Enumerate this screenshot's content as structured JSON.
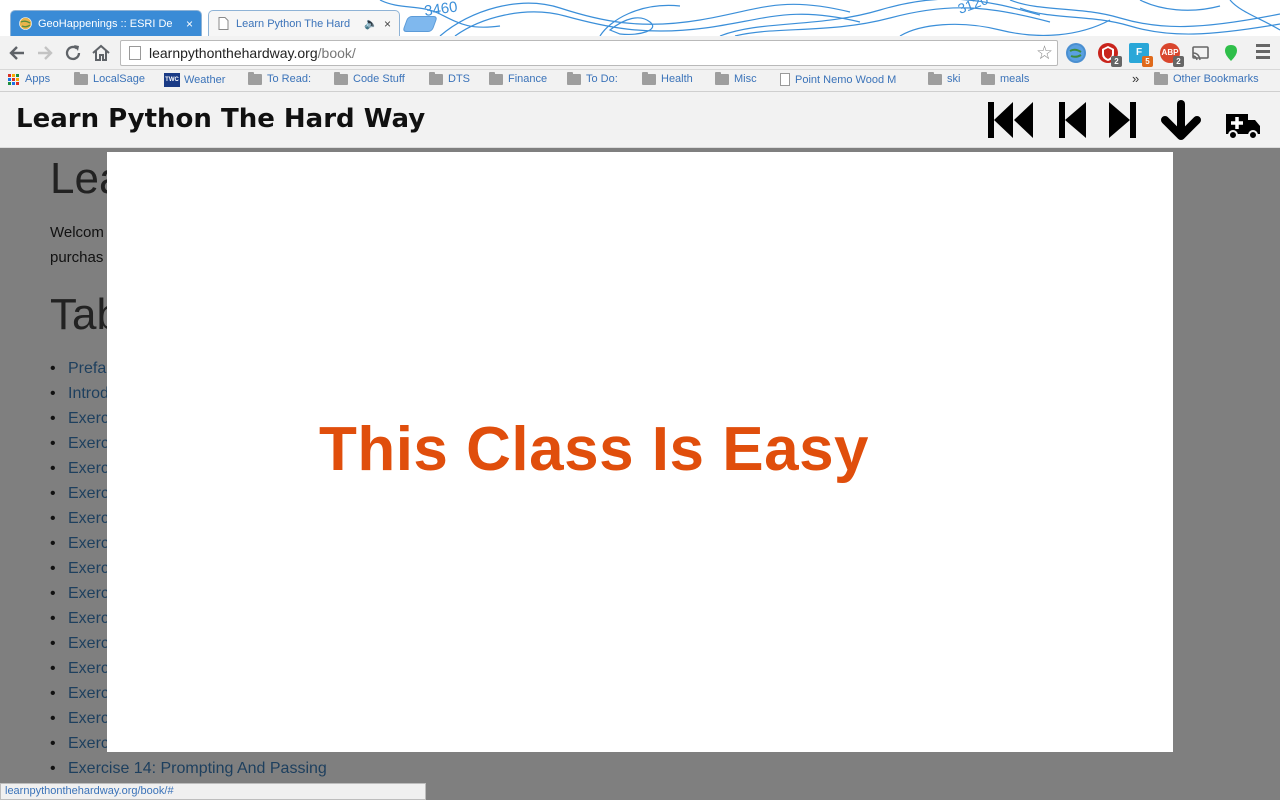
{
  "tabs": [
    {
      "title": "GeoHappenings :: ESRI De",
      "close": "×",
      "icon": "globe-icon"
    },
    {
      "title": "Learn Python The Hard",
      "close": "×",
      "icon": "page-icon",
      "audio": "🔈"
    }
  ],
  "topo_labels": [
    "3460",
    "3120"
  ],
  "omnibox": {
    "host": "learnpythonthehardway.org",
    "path": "/book/"
  },
  "extensions": [
    {
      "name": "globe-extension",
      "label": ""
    },
    {
      "name": "ublock-extension",
      "label": "",
      "badge": "2"
    },
    {
      "name": "feedly-extension",
      "label": "F",
      "badge": "5"
    },
    {
      "name": "adblock-plus-extension",
      "label": "ABP",
      "badge": "2"
    }
  ],
  "bookmarks": [
    {
      "label": "Apps",
      "kind": "apps"
    },
    {
      "label": "LocalSage",
      "kind": "folder"
    },
    {
      "label": "Weather",
      "kind": "twc",
      "badge_text": "TWC"
    },
    {
      "label": "To Read:",
      "kind": "folder"
    },
    {
      "label": "Code Stuff",
      "kind": "folder"
    },
    {
      "label": "DTS",
      "kind": "folder"
    },
    {
      "label": "Finance",
      "kind": "folder"
    },
    {
      "label": "To Do:",
      "kind": "folder"
    },
    {
      "label": "Health",
      "kind": "folder"
    },
    {
      "label": "Misc",
      "kind": "folder"
    },
    {
      "label": "Point Nemo Wood M",
      "kind": "doc"
    },
    {
      "label": "ski",
      "kind": "folder"
    },
    {
      "label": "meals",
      "kind": "folder"
    }
  ],
  "bookmarks_overflow": "»",
  "other_bookmarks": "Other Bookmarks",
  "site": {
    "title": "Learn Python The Hard Way",
    "nav": [
      "first-page",
      "previous-page",
      "next-page",
      "download",
      "help"
    ]
  },
  "page": {
    "heading": "Lea",
    "intro_lines": [
      "Welcom",
      "purchas"
    ],
    "toc_heading": "Tab",
    "toc": [
      "Prefa",
      "Introd",
      "Exerc",
      "Exerc",
      "Exerc",
      "Exerc",
      "Exerc",
      "Exerc",
      "Exerc",
      "Exerc",
      "Exerc",
      "Exerc",
      "Exerc",
      "Exerc",
      "Exerc",
      "Exerc",
      "Exercise 14: Prompting And Passing"
    ]
  },
  "slide": {
    "text": "This Class Is Easy",
    "color": "#e04e0c"
  },
  "status_url": "learnpythonthehardway.org/book/#",
  "colors": {
    "tab_active": "#3a8bd6",
    "link": "#3b73b9",
    "overlay": "#7f7f7f"
  }
}
